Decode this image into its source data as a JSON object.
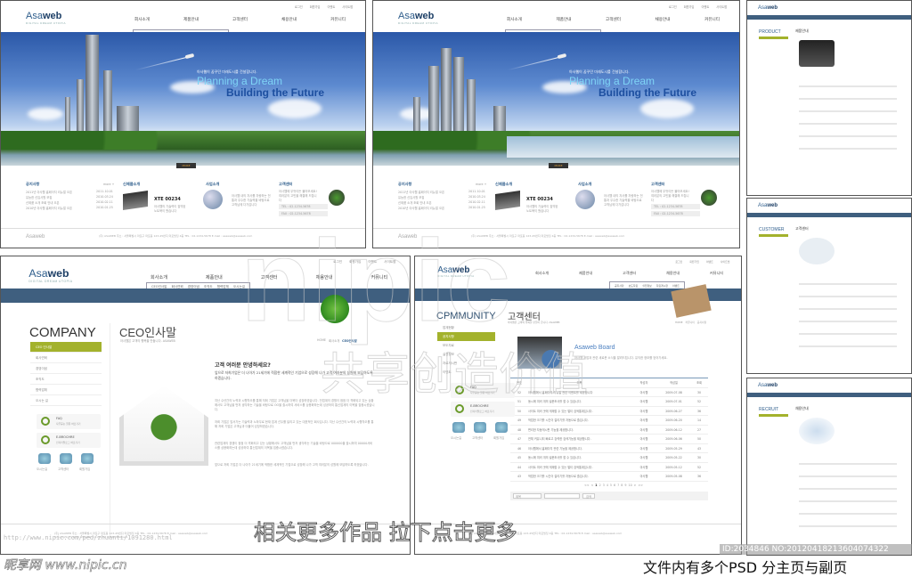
{
  "brand": {
    "name_a": "Asa",
    "name_b": "web",
    "tagline": "DIGITAL DREAM UTOPIA"
  },
  "top_links": [
    "로그인",
    "회원가입",
    "이벤트",
    "사이트맵"
  ],
  "nav": [
    "회사소개",
    "제품안내",
    "고객센터",
    "채용안내",
    "커뮤니티"
  ],
  "subnav_company": [
    "CEO인사말",
    "회사연혁",
    "경영이념",
    "조직도",
    "협력업체",
    "오시는길"
  ],
  "subnav_community": [
    "공지사항",
    "보도자료",
    "실전정보",
    "자료게시판",
    "이벤트"
  ],
  "hero": {
    "kicker": "아사웹이 꿈꾸던 미래도시를 건설합니다.",
    "line1": "Planning a Dream",
    "line2": "Building the Future",
    "more": "MORE"
  },
  "home": {
    "notice_title": "공지사항",
    "more": "more +",
    "notices": [
      {
        "t": "2011년 아사웹 홈페이지 리뉴얼 오픈",
        "d": "2011.10.01"
      },
      {
        "t": "유능한 신입사원 모집",
        "d": "2010.03.24"
      },
      {
        "t": "신제품 소개 조회 안내 오픈",
        "d": "2010.02.11"
      },
      {
        "t": "2010년 아사웹 홈페이지 리뉴얼 오픈",
        "d": "2010.01.25"
      }
    ],
    "new_product_title": "신제품소개",
    "product": "XTE 00234",
    "product_desc": "아사웹의 기술력이 집약된 노트북이 왔습니다",
    "business_title": "사업소개",
    "business_desc": "아사웹 내의 자사를 자랑하는 전통과 우수한 기술력을 바탕으로 고객님께 다가갑니다",
    "cs_title": "고객센터",
    "cs_desc": "아사웹에 무엇이든 물어보세요! 여러분의 고민을 해결해 드립니다",
    "tel": "TEL : 02-1234-5678",
    "fax": "FAX : 02-1234-5678"
  },
  "footer": {
    "address": "(주) ASAWEB 주소 : 서울특별시 마포구 마포동 123-45번지 마포빌딩 4층 TEL : 02-1234-5678  E-mail : asaweb@asaweb.com",
    "copyright": "Copyright (c) 2011 ASAweb. co.,ltd. All rights reserved."
  },
  "company": {
    "section": "COMPANY",
    "title": "CEO인사말",
    "subtitle": "아사웹은 고객의 행복을 만듭니다. ASAWEB",
    "breadcrumb": [
      "HOME",
      "회사소개",
      "CEO인사말"
    ],
    "menu": [
      "CEO 인사말",
      "회사연혁",
      "경영이념",
      "조직도",
      "협력업체",
      "오시는 길"
    ],
    "greeting": "고객 여러분 안녕하세요?",
    "lead": "앞으로 저희기업은 더 나아가 21세기에 적합한 세계적인 기업으로 성장해 나가 고객 여러분의 성원에 보답하도록 하겠습니다.",
    "paragraphs": [
      "지난 수년간의 노력과 시행착오를 통해 저희 기업은 고객님을 더욱더 성장하였습니다. 전업계의 경쟁이 점점 더 격화되고 있는 상황에서도 고객님을 먼저 생각하는 기술을 바탕으로 OO을 출시하여 서비스를 상용화하는데 성공하여 통신업계의 이목을 집중시켰습니다.",
      "저희 기업은 앞서가는 기술력과 노하우로 현재 업계 선두를 달리고 있는 대표적인 회사입니다. 지난 수년간의 노력과 시행착오를 통해 저희 기업은 고객님과 더불어 성장하였습니다.",
      "관련업계의 경쟁이 점점 더 격화되고 있는 상황에서도 고객님을 먼저 생각하는 기술을 바탕으로 000000을 출시하여 00000서비스를 상용화하는데 성공하여 통신업계의 이목을 집중시켰습니다.",
      "앞으로 저희 기업은 더 나아가 21세기에 적합한 세계적인 기업으로 성장해 나가 고객 여러분의 성원에 보답하도록 하겠습니다."
    ],
    "faq": "FAQ",
    "faq_desc": "자주묻는 질문 바로가기",
    "ebrochure": "E-BROCHRE",
    "ebrochure_desc": "전자카탈로그 바로가기",
    "quick": [
      "오시는길",
      "고객센터",
      "회원가입"
    ]
  },
  "community": {
    "section": "CPMMUNITY",
    "title": "고객센터",
    "subtitle": "아사웹은 고객의 행복을 만들어 갑니다. ASAWEB",
    "breadcrumb": [
      "HOME",
      "커뮤니티",
      "공지사항"
    ],
    "menu": [
      "업계현황",
      "공지사항",
      "보도자료",
      "실전정보",
      "자료게시판",
      "이벤트"
    ],
    "board_title": "Asaweb Board",
    "board_desc": "아사웹 사업과 관련 새로운 소식을 알려드립니다. 유익한 정보를 얻어가세요.",
    "columns": [
      "번호",
      "제목",
      "작성자",
      "작성일",
      "조회"
    ],
    "rows": [
      [
        "52",
        "아사웹에서 홈페이지 리뉴얼 관련 이벤트를 제공합니다",
        "아사웹",
        "2009-07-08",
        "30"
      ],
      [
        "51",
        "동시에 여러 개의 설문조사를 할 수 있습니다.",
        "아사웹",
        "2009-07-01",
        "52"
      ],
      [
        "50",
        "사이트 여러 곳에 게재할 수 있는 멀티 검색통계입니다.",
        "아사웹",
        "2009-06-27",
        "36"
      ],
      [
        "49",
        "작업한 크기를 시간이 걸리기를 자동으로 줄입니다.",
        "아사웹",
        "2009-06-20",
        "14"
      ],
      [
        "48",
        "편리한 자동게시판 기능을 제공합니다.",
        "아사웹",
        "2009-06-12",
        "27"
      ],
      [
        "47",
        "전체 커뮤니티 빠르고 강력한 검색기능을 제공합니다.",
        "아사웹",
        "2009-06-06",
        "50"
      ],
      [
        "46",
        "아사웹에서 홈페이지 관련 기능을 제공합니다.",
        "아사웹",
        "2009-05-29",
        "43"
      ],
      [
        "45",
        "동시에 여러 개의 설문조사를 할 수 있습니다.",
        "아사웹",
        "2009-05-22",
        "30"
      ],
      [
        "44",
        "사이트 여러 곳에 게재할 수 있는 멀티 검색통계입니다.",
        "아사웹",
        "2009-05-12",
        "52"
      ],
      [
        "43",
        "작업한 크기를 시간이 걸리기를 자동으로 줄입니다.",
        "아사웹",
        "2009-05-08",
        "36"
      ]
    ],
    "pagination": [
      "<<",
      "<",
      "1",
      "2",
      "3",
      "4",
      "5",
      "6",
      "7",
      "8",
      "9",
      "10",
      ">",
      ">>"
    ],
    "search_select": "제목",
    "search_button": "검색",
    "faq": "FAQ",
    "faq_desc": "자주묻는 질문 바로가기",
    "ebrochure": "E-BROCHRE",
    "ebrochure_desc": "전자카탈로그 바로가기",
    "quick": [
      "오시는길",
      "고객센터",
      "회원가입"
    ]
  },
  "thumbs": [
    {
      "section": "PRODUCT",
      "title": "제품안내"
    },
    {
      "section": "CUSTOMER",
      "title": "고객센터"
    },
    {
      "section": "RECRUIT",
      "title": "채용안내"
    }
  ],
  "watermark": {
    "site": "昵图网 www.nipic.com",
    "banner": "相关更多作品 拉下点击更多",
    "shared": "共享创造价值",
    "nipic": "nipic",
    "url": "http://www.nipic.com/ped/zhuanti/1091280.html",
    "user": "昵享网 www.nipic.cn",
    "id": "ID:2034846 NO:20120418213604074322",
    "note": "文件内有多个PSD 分主页与副页"
  },
  "colors": {
    "navy": "#3f5f7f",
    "olive": "#a3b22c",
    "brand": "#2f5e8c"
  }
}
